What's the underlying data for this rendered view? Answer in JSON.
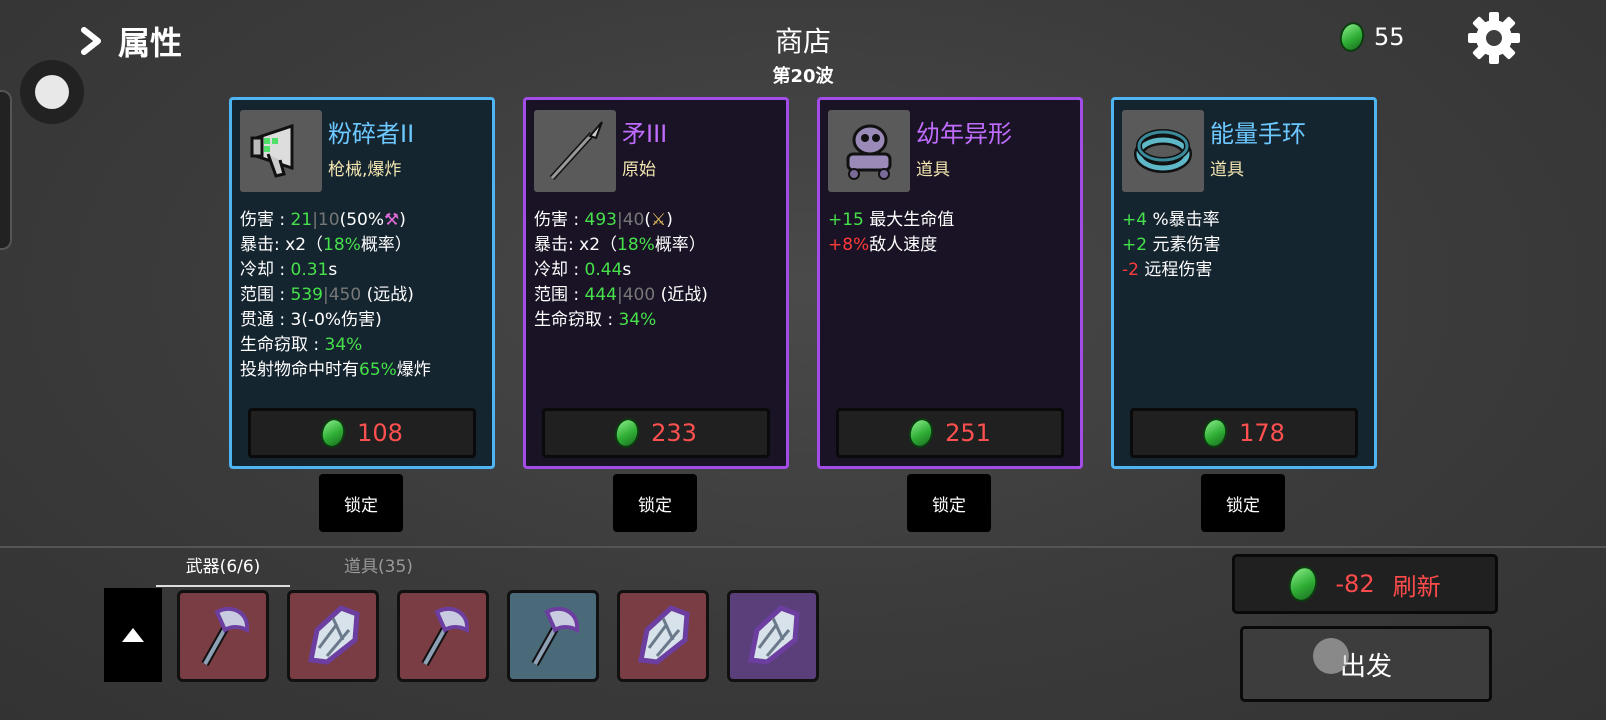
{
  "header": {
    "attributes_label": "属性",
    "shop_title": "商店",
    "wave_label": "第20波",
    "gold_amount": "55"
  },
  "cards": [
    {
      "name": "粉碎者II",
      "category": "枪械,爆炸",
      "rarity": "blue",
      "icon": "megaphone-gun-icon",
      "stats": [
        {
          "label": "伤害 : ",
          "value": "21",
          "extra": "10",
          "tail": "(50%",
          "icon": "pink-pickaxe-icon",
          "end": ")"
        },
        {
          "label": "暴击:  x2（",
          "value": "18%",
          "tail": "概率）"
        },
        {
          "label": "冷却 : ",
          "value": "0.31",
          "tail": "s"
        },
        {
          "label": "范围 : ",
          "value": "539",
          "extra": "450",
          "tail": " (远战)"
        },
        {
          "label": "贯通 : 3(-0%伤害)"
        },
        {
          "label": "生命窃取 : ",
          "value": "34%"
        },
        {
          "label": "投射物命中时有",
          "value": "65%",
          "tail": "爆炸"
        }
      ],
      "price": "108",
      "lock_label": "锁定"
    },
    {
      "name": "矛III",
      "category": "原始",
      "rarity": "purple",
      "icon": "spear-icon",
      "stats": [
        {
          "label": "伤害 : ",
          "value": "493",
          "extra": "40",
          "tail": "(",
          "icon": "sword-icon",
          "end": ")"
        },
        {
          "label": "暴击:  x2（",
          "value": "18%",
          "tail": "概率）"
        },
        {
          "label": "冷却 : ",
          "value": "0.44",
          "tail": "s"
        },
        {
          "label": "范围 : ",
          "value": "444",
          "extra": "400",
          "tail": " (近战)"
        },
        {
          "label": "生命窃取 : ",
          "value": "34%"
        }
      ],
      "price": "233",
      "lock_label": "锁定"
    },
    {
      "name": "幼年异形",
      "category": "道具",
      "rarity": "purple",
      "icon": "baby-alien-icon",
      "effects": [
        {
          "value": "+15",
          "color": "green",
          "text": " 最大生命值"
        },
        {
          "value": "+8%",
          "color": "red",
          "text": "敌人速度"
        }
      ],
      "price": "251",
      "lock_label": "锁定"
    },
    {
      "name": "能量手环",
      "category": "道具",
      "rarity": "blue",
      "icon": "energy-bracelet-icon",
      "effects": [
        {
          "value": "+4",
          "color": "green",
          "text": " %暴击率"
        },
        {
          "value": "+2",
          "color": "green",
          "text": " 元素伤害"
        },
        {
          "value": "-2",
          "color": "red",
          "text": " 远程伤害"
        }
      ],
      "price": "178",
      "lock_label": "锁定"
    }
  ],
  "inventory": {
    "weapons_tab": "武器(6/6)",
    "items_tab": "道具(35)",
    "slots": [
      {
        "icon": "axe-icon",
        "tier": "red"
      },
      {
        "icon": "crystal-shard-icon",
        "tier": "red"
      },
      {
        "icon": "axe-icon",
        "tier": "red"
      },
      {
        "icon": "axe-icon",
        "tier": "blue"
      },
      {
        "icon": "crystal-shard-icon",
        "tier": "red"
      },
      {
        "icon": "crystal-shard-icon",
        "tier": "purple"
      }
    ]
  },
  "actions": {
    "refresh_cost": "-82",
    "refresh_label": "刷新",
    "go_label": "出发"
  }
}
